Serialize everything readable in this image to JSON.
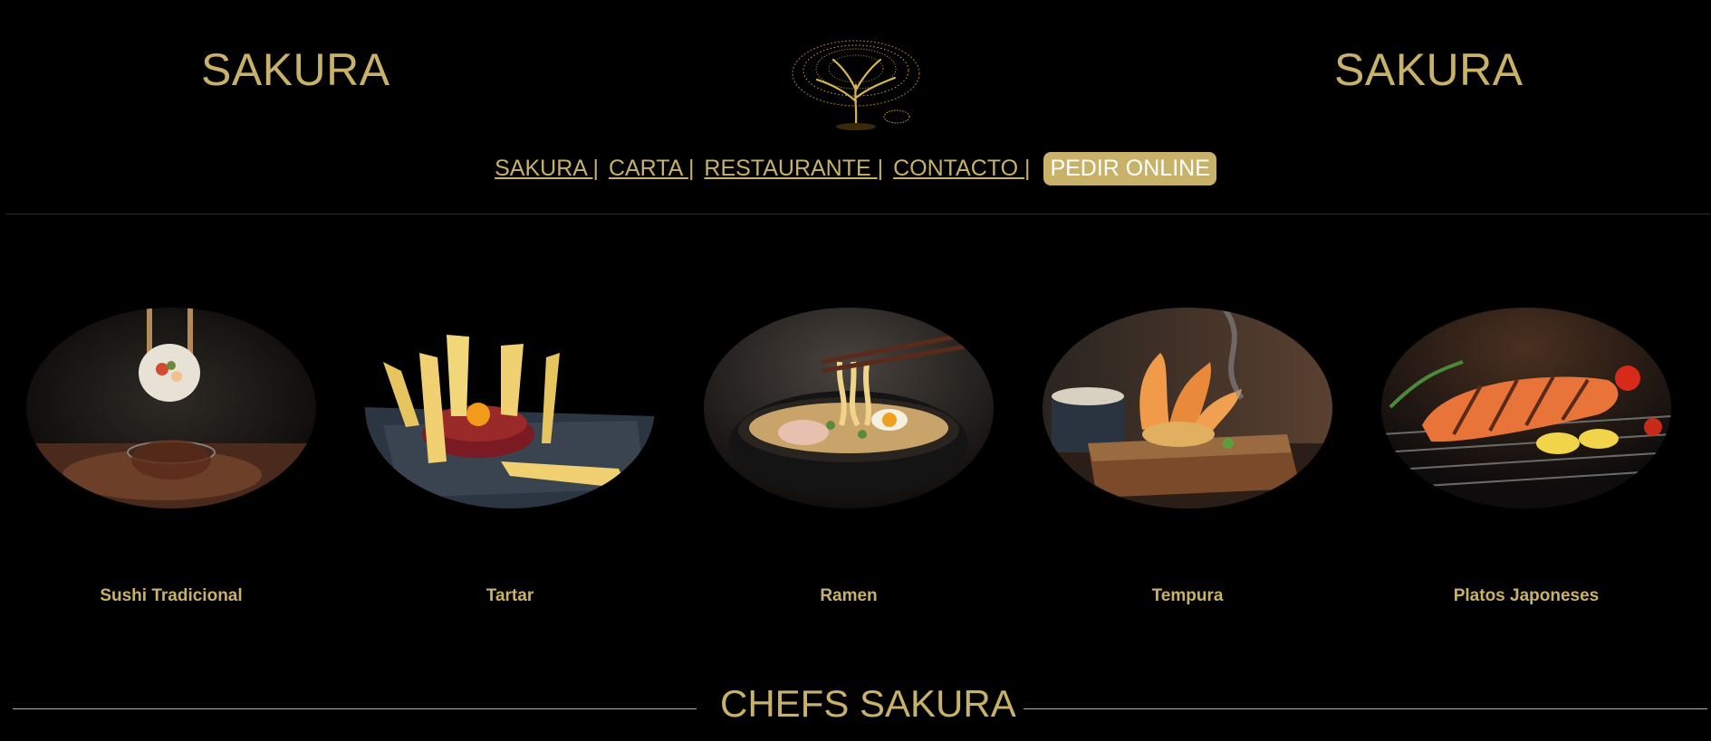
{
  "header": {
    "brand_left": "SAKURA",
    "brand_right": "SAKURA"
  },
  "nav": {
    "items": [
      {
        "label": "SAKURA "
      },
      {
        "label": "CARTA "
      },
      {
        "label": "RESTAURANTE "
      },
      {
        "label": "CONTACTO "
      }
    ],
    "separator": "|",
    "order_label": "PEDIR ONLINE"
  },
  "dishes": [
    {
      "name": "Sushi Tradicional"
    },
    {
      "name": "Tartar"
    },
    {
      "name": "Ramen"
    },
    {
      "name": "Tempura"
    },
    {
      "name": "Platos Japoneses"
    }
  ],
  "chefs": {
    "title": "CHEFS SAKURA"
  },
  "colors": {
    "accent": "#c8b26a",
    "background": "#000000"
  }
}
